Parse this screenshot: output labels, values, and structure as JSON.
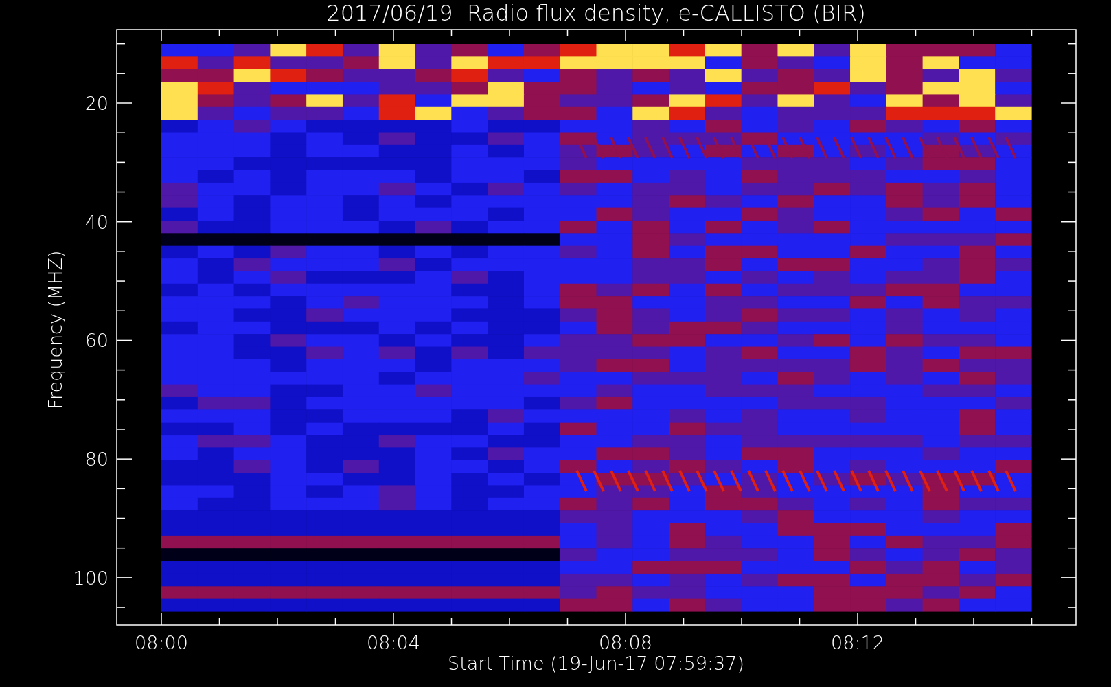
{
  "plot": {
    "title": "2017/06/19  Radio flux density, e-CALLISTO (BIR)",
    "ylabel": "Frequency (MHZ)",
    "xlabel": "Start Time (19-Jun-17 07:59:37)",
    "yticks": [
      "20",
      "40",
      "60",
      "80",
      "100"
    ],
    "xticks": [
      "08:00",
      "08:04",
      "08:08",
      "08:12"
    ]
  }
}
